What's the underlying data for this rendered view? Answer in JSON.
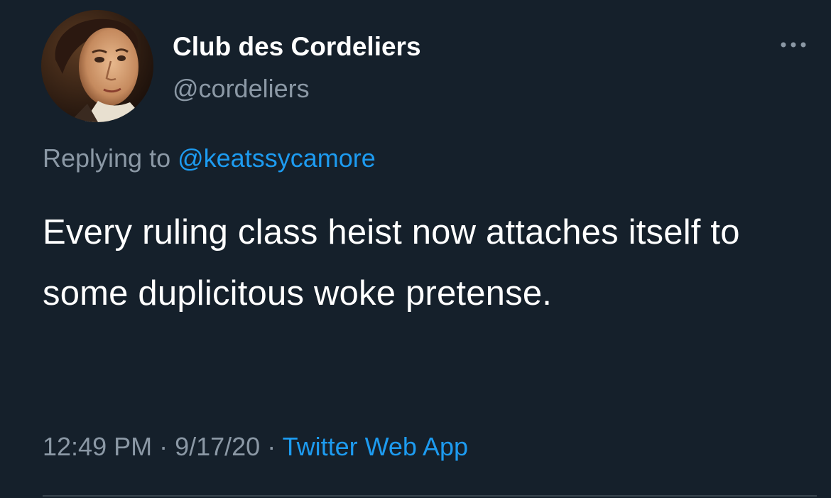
{
  "tweet": {
    "author": {
      "display_name": "Club des Cordeliers",
      "handle": "@cordeliers",
      "avatar_icon": "portrait-avatar"
    },
    "replying_to": {
      "prefix": "Replying to ",
      "mention": "@keatssycamore"
    },
    "text": "Every ruling class heist now attaches itself to some duplicitous woke pretense.",
    "meta": {
      "time": "12:49 PM",
      "sep1": " · ",
      "date": "9/17/20",
      "sep2": " · ",
      "source": "Twitter Web App"
    },
    "more_icon": "more-options-icon"
  },
  "colors": {
    "background": "#15202b",
    "primary_text": "#ffffff",
    "secondary_text": "#8b98a5",
    "link": "#1d9bf0",
    "divider": "#38444d"
  }
}
